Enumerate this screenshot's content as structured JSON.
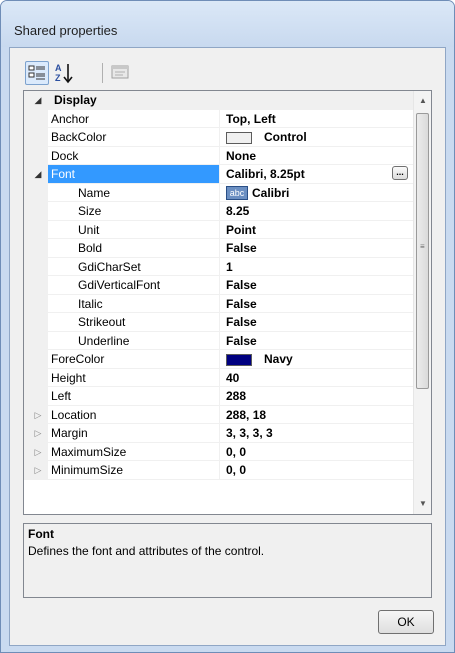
{
  "window": {
    "title": "Shared properties"
  },
  "toolbar": {
    "categorized_icon": "categorized-view-icon",
    "alphabetical_icon": "alphabetical-sort-icon",
    "property_pages_icon": "property-pages-icon"
  },
  "grid": {
    "category": "Display",
    "rows": [
      {
        "name": "Anchor",
        "value": "Top, Left"
      },
      {
        "name": "BackColor",
        "value": "Control",
        "swatch": "#f0f0f0"
      },
      {
        "name": "Dock",
        "value": "None"
      },
      {
        "name": "Font",
        "value": "Calibri, 8.25pt",
        "expanded": true,
        "selected": true,
        "ellipsis": "..."
      },
      {
        "name": "Name",
        "value": "Calibri",
        "sub": true,
        "badge": "abc"
      },
      {
        "name": "Size",
        "value": "8.25",
        "sub": true
      },
      {
        "name": "Unit",
        "value": "Point",
        "sub": true
      },
      {
        "name": "Bold",
        "value": "False",
        "sub": true
      },
      {
        "name": "GdiCharSet",
        "value": "1",
        "sub": true
      },
      {
        "name": "GdiVerticalFont",
        "value": "False",
        "sub": true
      },
      {
        "name": "Italic",
        "value": "False",
        "sub": true
      },
      {
        "name": "Strikeout",
        "value": "False",
        "sub": true
      },
      {
        "name": "Underline",
        "value": "False",
        "sub": true
      },
      {
        "name": "ForeColor",
        "value": "Navy",
        "swatch": "#000080"
      },
      {
        "name": "Height",
        "value": "40"
      },
      {
        "name": "Left",
        "value": "288"
      },
      {
        "name": "Location",
        "value": "288, 18",
        "collapsed": true
      },
      {
        "name": "Margin",
        "value": "3, 3, 3, 3",
        "collapsed": true
      },
      {
        "name": "MaximumSize",
        "value": "0, 0",
        "collapsed": true
      },
      {
        "name": "MinimumSize",
        "value": "0, 0",
        "collapsed": true
      }
    ]
  },
  "help": {
    "title": "Font",
    "description": "Defines the font and attributes of the control."
  },
  "buttons": {
    "ok": "OK"
  },
  "colors": {
    "selection": "#3399ff",
    "window_frame": "#c9daf0"
  }
}
